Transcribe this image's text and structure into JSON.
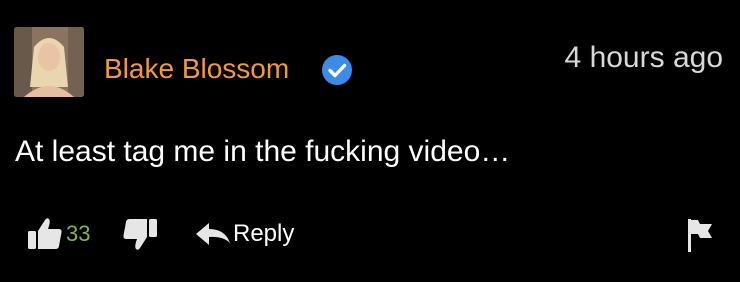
{
  "comment": {
    "username": "Blake Blossom",
    "verified": true,
    "timestamp": "4 hours ago",
    "text": "At least tag me in the fucking video…",
    "likes": "33",
    "reply_label": "Reply"
  },
  "colors": {
    "background": "#000000",
    "username": "#f29a3a",
    "verified_badge": "#3d8be8",
    "like_count": "#8ab04a",
    "icon": "#e6e6e6"
  },
  "icons": [
    "verified-badge-icon",
    "thumbs-up-icon",
    "thumbs-down-icon",
    "reply-arrow-icon",
    "flag-icon"
  ]
}
